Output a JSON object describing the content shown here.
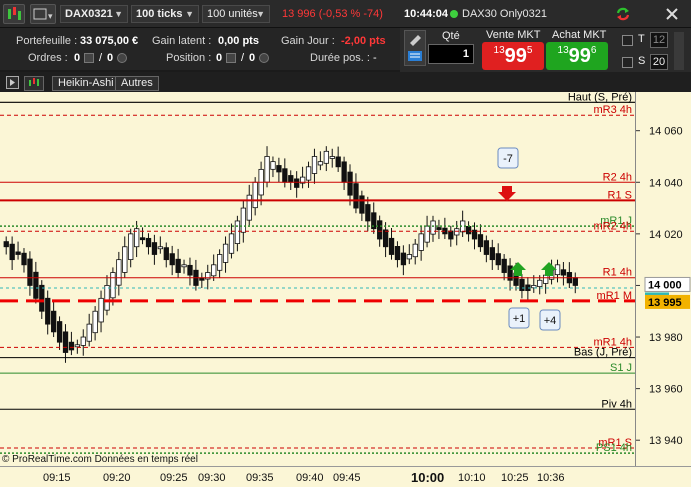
{
  "toolbar": {
    "instrument": "DAX0321",
    "ticks": "100 ticks",
    "units": "100 unités",
    "last_price": "13 996 (-0,53 % -74)",
    "time": "10:44:04",
    "market_name": "DAX30 Only0321"
  },
  "account": {
    "portfolio_label": "Portefeuille :",
    "portfolio_value": "33 075,00 €",
    "latent_label": "Gain latent :",
    "latent_value": "0,00 pts",
    "day_label": "Gain Jour :",
    "day_value": "-2,00 pts",
    "orders_label": "Ordres :",
    "orders_value": "0",
    "orders_sep": "/",
    "orders_value2": "0",
    "position_label": "Position :",
    "position_value": "0",
    "position_sep": "/",
    "position_value2": "0",
    "duration_label": "Durée pos. :",
    "duration_value": "-"
  },
  "trade": {
    "qty_label": "Qté",
    "qty_value": "1",
    "sell_label": "Vente MKT",
    "sell_prefix": "13",
    "sell_big": "99",
    "sell_sup": "5",
    "buy_label": "Achat MKT",
    "buy_prefix": "13",
    "buy_big": "99",
    "buy_sup": "6",
    "t_label": "T",
    "s_label": "S",
    "num1": "12",
    "num2": "20",
    "sell_color": "#e02020",
    "buy_color": "#1fa51f"
  },
  "chart_tabs": [
    "Heikin-Ashi",
    "Autres"
  ],
  "levels": [
    {
      "name": "Haut (S, Pré)",
      "price": 14071,
      "color": "#000000",
      "style": "solid",
      "width": 1.2,
      "lbl_color": "#000000"
    },
    {
      "name": "mR3 4h",
      "price": 14066,
      "color": "#cc0000",
      "style": "dashed",
      "width": 1,
      "lbl_color": "#cc0000"
    },
    {
      "name": "R2 4h",
      "price": 14040,
      "color": "#cc0000",
      "style": "solid",
      "width": 1,
      "lbl_color": "#cc0000"
    },
    {
      "name": "R1 S",
      "price": 14033,
      "color": "#cc0000",
      "style": "solid",
      "width": 2,
      "lbl_color": "#cc0000"
    },
    {
      "name": "mR1 J",
      "price": 14023,
      "color": "#2a8a2a",
      "style": "dotted",
      "width": 1.5,
      "lbl_color": "#2a8a2a"
    },
    {
      "name": "mR2 4h",
      "price": 14021,
      "color": "#cc0000",
      "style": "dashed",
      "width": 1,
      "lbl_color": "#cc0000"
    },
    {
      "name": "R1 4h",
      "price": 14003,
      "color": "#cc0000",
      "style": "solid",
      "width": 1,
      "lbl_color": "#cc0000"
    },
    {
      "name": "mR1 M",
      "price": 13994,
      "color": "#ee0000",
      "style": "bigdash",
      "width": 3,
      "lbl_color": "#cc0000"
    },
    {
      "name": "mR1 4h",
      "price": 13976,
      "color": "#cc0000",
      "style": "dashed",
      "width": 1,
      "lbl_color": "#cc0000"
    },
    {
      "name": "Bas (J, Pré)",
      "price": 13972,
      "color": "#000000",
      "style": "solid",
      "width": 1,
      "lbl_color": "#000000"
    },
    {
      "name": "S1 J",
      "price": 13966,
      "color": "#2a8a2a",
      "style": "solid",
      "width": 1,
      "lbl_color": "#2a8a2a"
    },
    {
      "name": "Piv 4h",
      "price": 13952,
      "color": "#000000",
      "style": "solid",
      "width": 1,
      "lbl_color": "#000000"
    },
    {
      "name": "mR1 S",
      "price": 13937,
      "color": "#cc0000",
      "style": "dashed",
      "width": 1,
      "lbl_color": "#cc0000"
    },
    {
      "name": "PS1 4h",
      "price": 13935,
      "color": "#2a8a2a",
      "style": "dotted",
      "width": 1.5,
      "lbl_color": "#2a8a2a"
    }
  ],
  "y_ticks": [
    "14 060",
    "14 040",
    "14 020",
    "14 000",
    "13 980",
    "13 960",
    "13 940"
  ],
  "current_price_label": "14 000",
  "countdown": "32T",
  "current_bid_label": "13 995",
  "x_ticks": [
    "09:15",
    "09:20",
    "09:25",
    "09:30",
    "09:35",
    "09:40",
    "09:45",
    "10:00",
    "10:10",
    "10:25",
    "10:36"
  ],
  "x_tick_bold": "10:00",
  "footer": "© ProRealTime.com  Données en temps réel",
  "signals": [
    {
      "label": "-7",
      "type": "sell"
    },
    {
      "label": "+1",
      "type": "buy"
    },
    {
      "label": "+4",
      "type": "buy"
    }
  ],
  "chart_data": {
    "type": "candlestick",
    "ylim": [
      13930,
      14075
    ],
    "candles_close": [
      14015,
      14010,
      14012,
      14008,
      14000,
      13995,
      13990,
      13985,
      13982,
      13978,
      13974,
      13975,
      13977,
      13980,
      13985,
      13990,
      13995,
      14000,
      14005,
      14010,
      14015,
      14020,
      14022,
      14018,
      14015,
      14012,
      14015,
      14010,
      14008,
      14005,
      14008,
      14004,
      14000,
      14002,
      14005,
      14008,
      14012,
      14016,
      14020,
      14025,
      14030,
      14035,
      14040,
      14045,
      14050,
      14048,
      14044,
      14040,
      14040,
      14038,
      14042,
      14046,
      14050,
      14048,
      14052,
      14050,
      14046,
      14040,
      14035,
      14030,
      14028,
      14025,
      14022,
      14018,
      14015,
      14012,
      14010,
      14008,
      14012,
      14016,
      14020,
      14023,
      14025,
      14022,
      14020,
      14018,
      14022,
      14025,
      14020,
      14018,
      14015,
      14012,
      14010,
      14008,
      14005,
      14002,
      14000,
      13998,
      13998,
      14000,
      14002,
      14004,
      14006,
      14008,
      14004,
      14001,
      14000
    ]
  }
}
